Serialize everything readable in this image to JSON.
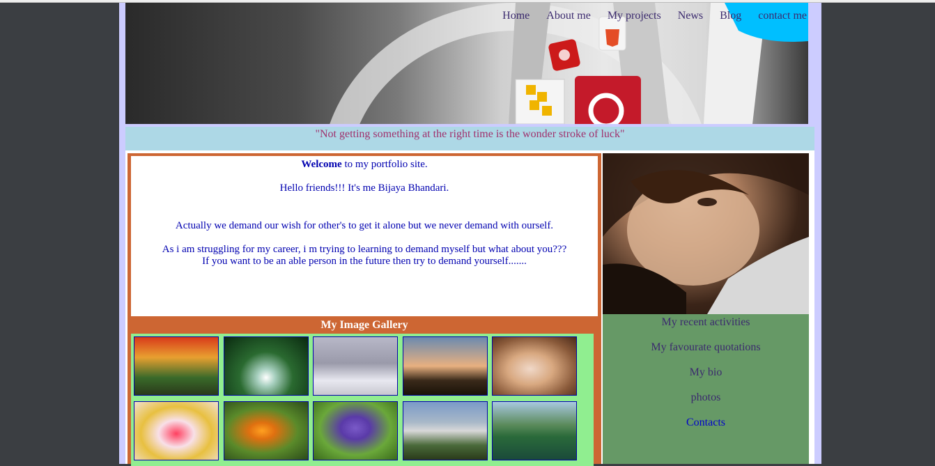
{
  "nav": {
    "items": [
      "Home",
      "About me",
      "My projects",
      "News",
      "Blog",
      "contact me"
    ]
  },
  "quote": "\"Not getting something at the right time is the wonder stroke of luck\"",
  "welcome": {
    "bold": "Welcome",
    "rest": " to my portfolio site.",
    "hello": "Hello friends!!! It's me Bijaya Bhandari.",
    "para1": "Actually we demand our wish for other's to get it alone but we never demand with ourself.",
    "para2a": "As i am struggling for my career, i m trying to learning to demand myself but what about you???",
    "para2b": "If you want to be an able person in the future then try to demand yourself......."
  },
  "gallery": {
    "title": "My Image Gallery",
    "thumbs": [
      "autumn-garden",
      "waterfall",
      "snowy-field",
      "lighthouse",
      "kitten-hat",
      "girl-flowers",
      "goldfish",
      "iris-flowers",
      "castle",
      "mountain-lake"
    ]
  },
  "sidebar": {
    "links": [
      "My recent activities",
      "My favourate quotations",
      "My bio",
      "photos",
      "Contacts"
    ]
  },
  "colors": {
    "page_frame": "#ccccff",
    "quote_bg": "#add8e6",
    "left_col": "#cd6633",
    "gallery_bg": "#90ee90",
    "right_col": "#669966"
  }
}
